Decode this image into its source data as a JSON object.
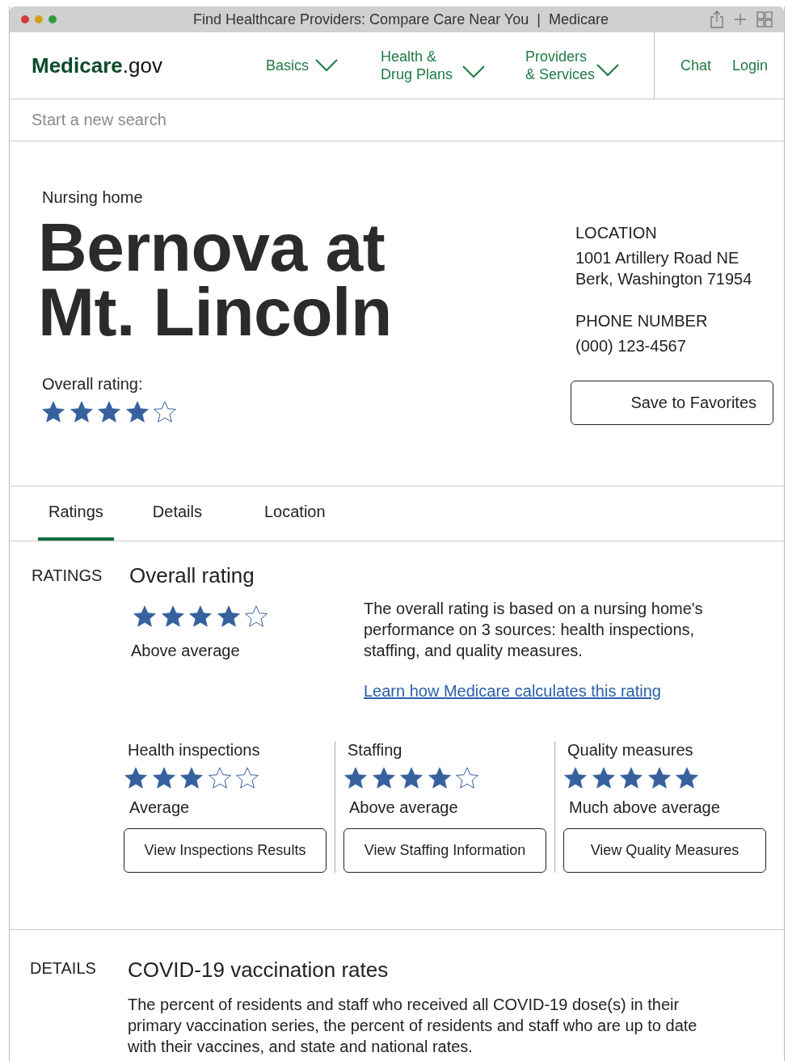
{
  "window": {
    "title": "Find Healthcare Providers: Compare Care Near You  |  Medicare"
  },
  "nav": {
    "logo": {
      "bold": "Medicare",
      "rest": ".gov"
    },
    "menus": [
      {
        "lines": [
          "Basics"
        ]
      },
      {
        "lines": [
          "Health &",
          "Drug Plans"
        ]
      },
      {
        "lines": [
          "Providers",
          "& Services"
        ]
      }
    ],
    "links": [
      "Chat",
      "Login"
    ]
  },
  "search": {
    "placeholder": "Start a new search"
  },
  "provider": {
    "type": "Nursing home",
    "name_lines": [
      "Bernova at",
      "Mt. Lincoln"
    ],
    "rating_label": "Overall rating:",
    "stars": 4,
    "location_label": "LOCATION",
    "address_lines": [
      "1001 Artillery Road NE",
      "Berk, Washington 71954"
    ],
    "phone_label": "PHONE NUMBER",
    "phone": "(000) 123-4567",
    "save_button": "Save to Favorites"
  },
  "tabs": [
    {
      "label": "Ratings",
      "selected": true
    },
    {
      "label": "Details",
      "selected": false
    },
    {
      "label": "Location",
      "selected": false
    }
  ],
  "ratings": {
    "section_label": "RATINGS",
    "heading": "Overall rating",
    "stars": 4,
    "summary": "Above average",
    "description": "The overall rating is based on a nursing home's performance on 3 sources: health inspections, staffing, and quality measures.",
    "link": "Learn how Medicare calculates this rating",
    "categories": [
      {
        "title": "Health inspections",
        "stars": 3,
        "summary": "Average",
        "button": "View Inspections Results"
      },
      {
        "title": "Staffing",
        "stars": 4,
        "summary": "Above average",
        "button": "View Staffing Information"
      },
      {
        "title": "Quality measures",
        "stars": 5,
        "summary": "Much above average",
        "button": "View Quality Measures"
      }
    ]
  },
  "details": {
    "section_label": "DETAILS",
    "heading": "COVID-19 vaccination rates",
    "text": "The percent of residents and staff who received all COVID-19 dose(s) in their primary vaccination series, the percent of residents and staff who are up to date with their vaccines, and state and national rates."
  }
}
